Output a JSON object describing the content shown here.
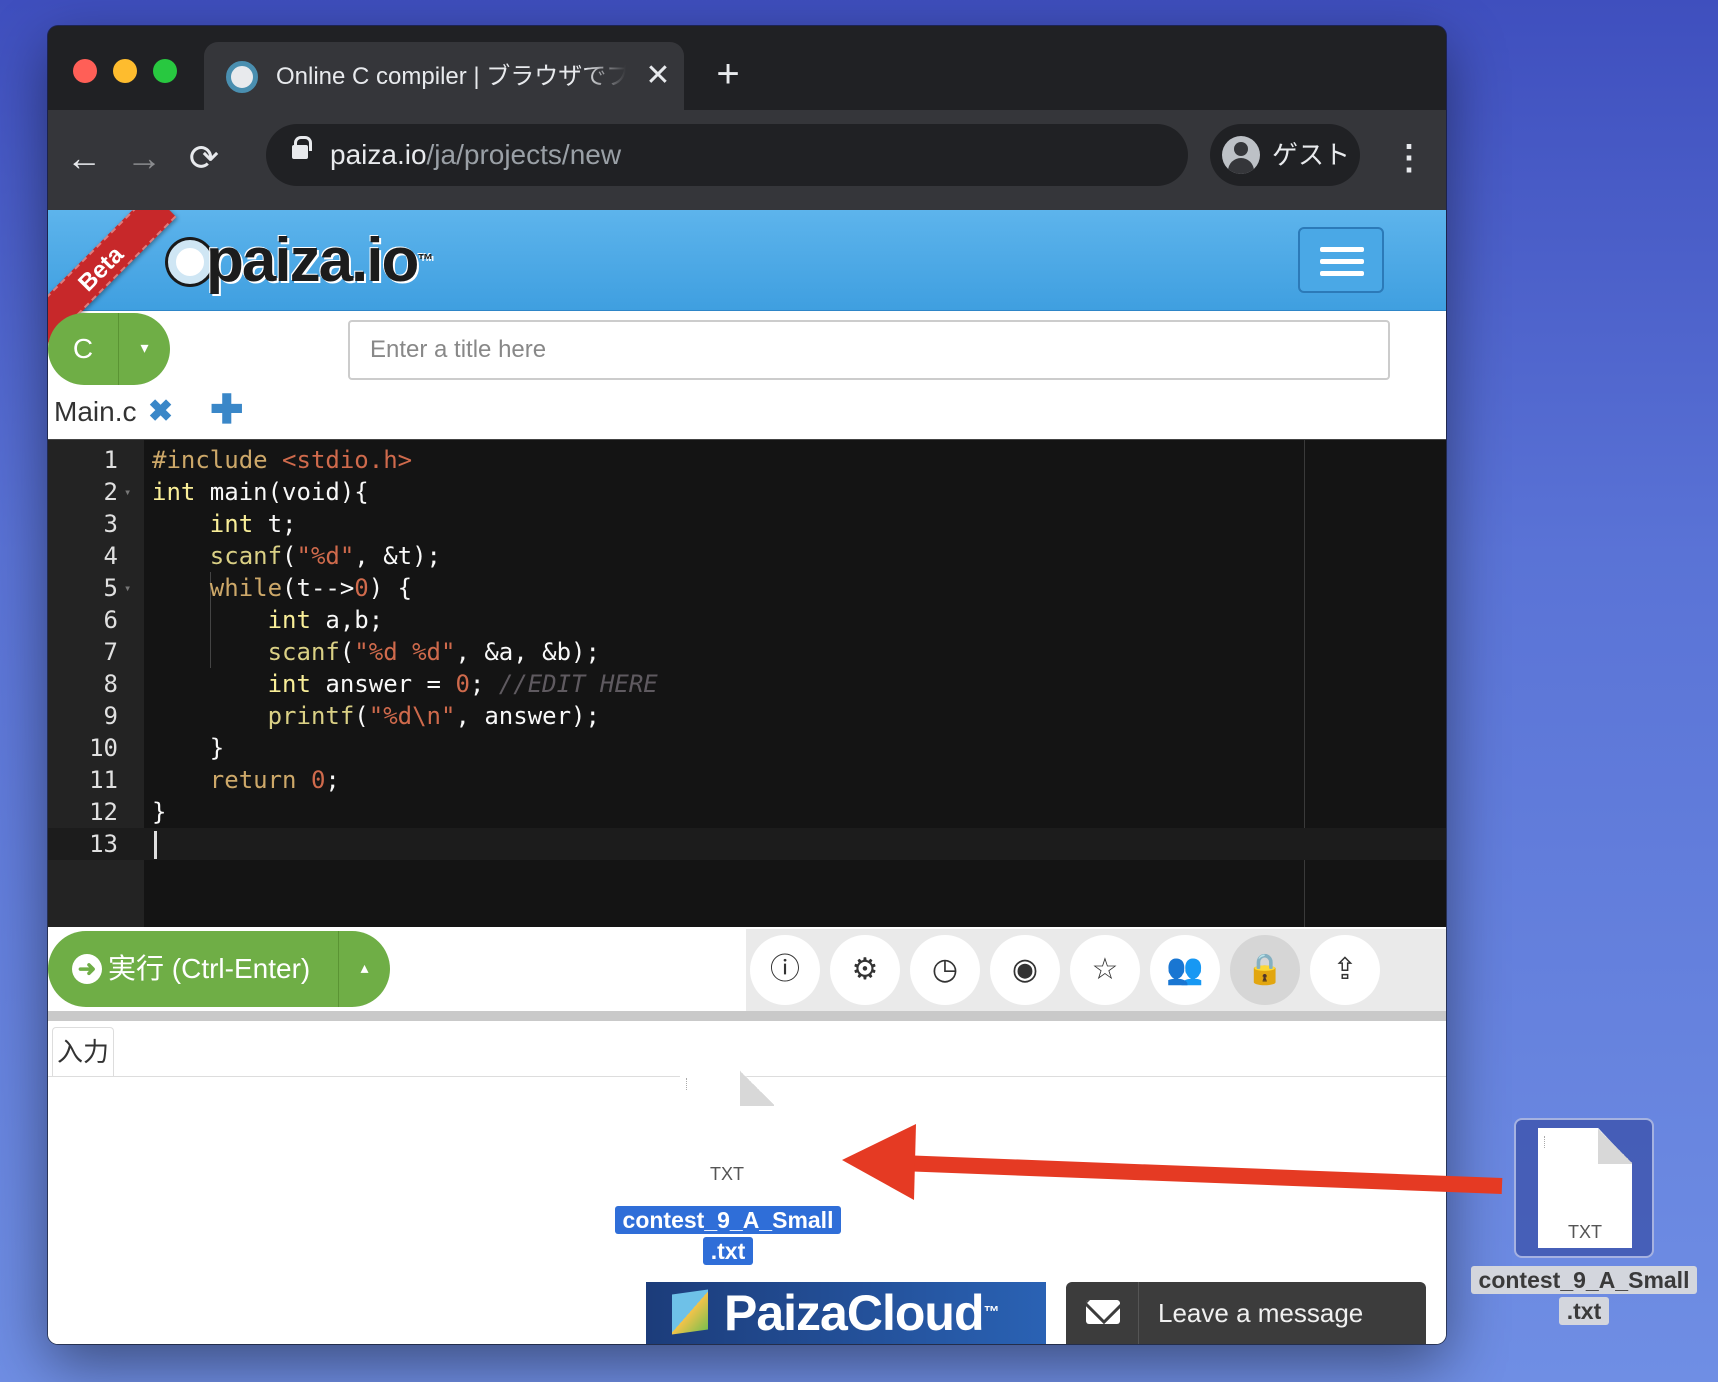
{
  "browser": {
    "tab_title": "Online C compiler | ブラウザでプログラミング",
    "tab_close": "✕",
    "new_tab": "+",
    "back": "←",
    "forward": "→",
    "reload": "⟳",
    "url_host": "paiza.io",
    "url_path": "/ja/projects/new",
    "profile_label": "ゲスト",
    "menu": "⋮"
  },
  "site": {
    "beta_label": "Beta",
    "logo_text": "paiza.io",
    "logo_tm": "™"
  },
  "project": {
    "language": "C",
    "language_caret": "▾",
    "title_placeholder": "Enter a title here",
    "file_tab": "Main.c",
    "file_close": "✖",
    "add_file": "✚"
  },
  "editor": {
    "lines": [
      {
        "n": "1",
        "fold": ""
      },
      {
        "n": "2",
        "fold": "▾"
      },
      {
        "n": "3",
        "fold": ""
      },
      {
        "n": "4",
        "fold": ""
      },
      {
        "n": "5",
        "fold": "▾"
      },
      {
        "n": "6",
        "fold": ""
      },
      {
        "n": "7",
        "fold": ""
      },
      {
        "n": "8",
        "fold": ""
      },
      {
        "n": "9",
        "fold": ""
      },
      {
        "n": "10",
        "fold": ""
      },
      {
        "n": "11",
        "fold": ""
      },
      {
        "n": "12",
        "fold": ""
      },
      {
        "n": "13",
        "fold": ""
      }
    ],
    "code": [
      [
        [
          "pre",
          "#include "
        ],
        [
          "str",
          "<stdio.h>"
        ]
      ],
      [
        [
          "type",
          "int"
        ],
        [
          "",
          " main(void){"
        ]
      ],
      [
        [
          "",
          "    "
        ],
        [
          "type",
          "int"
        ],
        [
          "",
          " t;"
        ]
      ],
      [
        [
          "",
          "    "
        ],
        [
          "fn",
          "scanf"
        ],
        [
          "",
          "("
        ],
        [
          "str",
          "\"%d\""
        ],
        [
          "",
          ", &t);"
        ]
      ],
      [
        [
          "",
          "    "
        ],
        [
          "key",
          "while"
        ],
        [
          "",
          "(t-->"
        ],
        [
          "num",
          "0"
        ],
        [
          "",
          ") {"
        ]
      ],
      [
        [
          "",
          "        "
        ],
        [
          "type",
          "int"
        ],
        [
          "",
          " a,b;"
        ]
      ],
      [
        [
          "",
          "        "
        ],
        [
          "fn",
          "scanf"
        ],
        [
          "",
          "("
        ],
        [
          "str",
          "\"%d %d\""
        ],
        [
          "",
          ", &a, &b);"
        ]
      ],
      [
        [
          "",
          "        "
        ],
        [
          "type",
          "int"
        ],
        [
          "",
          " answer = "
        ],
        [
          "num",
          "0"
        ],
        [
          "",
          "; "
        ],
        [
          "com",
          "//EDIT HERE"
        ]
      ],
      [
        [
          "",
          "        "
        ],
        [
          "fn",
          "printf"
        ],
        [
          "",
          "("
        ],
        [
          "str",
          "\"%d\\n\""
        ],
        [
          "",
          ", answer);"
        ]
      ],
      [
        [
          "",
          "    }"
        ]
      ],
      [
        [
          "",
          "    "
        ],
        [
          "key",
          "return"
        ],
        [
          "",
          " "
        ],
        [
          "num",
          "0"
        ],
        [
          "",
          ";"
        ]
      ],
      [
        [
          "",
          "}"
        ]
      ],
      []
    ]
  },
  "runbar": {
    "run_icon": "➜",
    "run_label": "実行 (Ctrl-Enter)",
    "run_caret": "▴",
    "tools": [
      {
        "name": "info-icon",
        "glyph": "ⓘ"
      },
      {
        "name": "settings-gear-icon",
        "glyph": "⚙"
      },
      {
        "name": "history-clock-icon",
        "glyph": "◷"
      },
      {
        "name": "github-icon",
        "glyph": "◉"
      },
      {
        "name": "favorite-star-icon",
        "glyph": "☆"
      },
      {
        "name": "collaborators-users-icon",
        "glyph": "👥"
      },
      {
        "name": "private-lock-icon",
        "glyph": "🔒"
      },
      {
        "name": "share-icon",
        "glyph": "⇪"
      }
    ]
  },
  "io": {
    "input_tab": "入力"
  },
  "dragged_file": {
    "ext": "TXT",
    "name_line1": "contest_9_A_Small",
    "name_line2": ".txt"
  },
  "ghost_file": {
    "ext": "TXT",
    "name_line1": "contest_9_A_Small",
    "name_line2": ".txt"
  },
  "banners": {
    "cloud_text": "PaizaCloud",
    "cloud_tm": "™",
    "message_text": "Leave a message"
  },
  "colors": {
    "annotation_arrow": "#e53a23",
    "run_green": "#6fae46",
    "header_blue": "#3f9fe0"
  }
}
